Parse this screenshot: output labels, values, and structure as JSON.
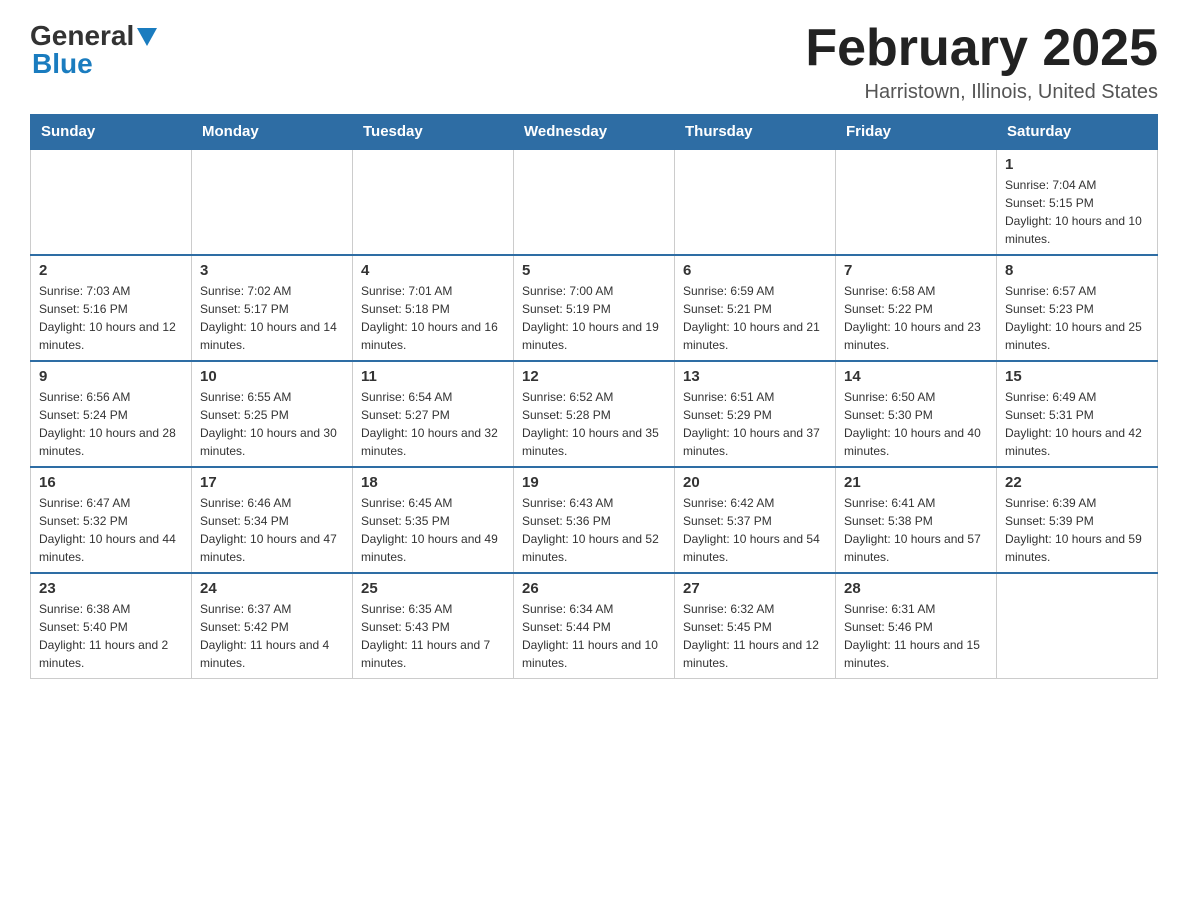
{
  "header": {
    "logo": {
      "general_text": "General",
      "blue_text": "Blue"
    },
    "title": "February 2025",
    "subtitle": "Harristown, Illinois, United States"
  },
  "days_of_week": [
    "Sunday",
    "Monday",
    "Tuesday",
    "Wednesday",
    "Thursday",
    "Friday",
    "Saturday"
  ],
  "weeks": [
    [
      {
        "day": "",
        "info": ""
      },
      {
        "day": "",
        "info": ""
      },
      {
        "day": "",
        "info": ""
      },
      {
        "day": "",
        "info": ""
      },
      {
        "day": "",
        "info": ""
      },
      {
        "day": "",
        "info": ""
      },
      {
        "day": "1",
        "info": "Sunrise: 7:04 AM\nSunset: 5:15 PM\nDaylight: 10 hours and 10 minutes."
      }
    ],
    [
      {
        "day": "2",
        "info": "Sunrise: 7:03 AM\nSunset: 5:16 PM\nDaylight: 10 hours and 12 minutes."
      },
      {
        "day": "3",
        "info": "Sunrise: 7:02 AM\nSunset: 5:17 PM\nDaylight: 10 hours and 14 minutes."
      },
      {
        "day": "4",
        "info": "Sunrise: 7:01 AM\nSunset: 5:18 PM\nDaylight: 10 hours and 16 minutes."
      },
      {
        "day": "5",
        "info": "Sunrise: 7:00 AM\nSunset: 5:19 PM\nDaylight: 10 hours and 19 minutes."
      },
      {
        "day": "6",
        "info": "Sunrise: 6:59 AM\nSunset: 5:21 PM\nDaylight: 10 hours and 21 minutes."
      },
      {
        "day": "7",
        "info": "Sunrise: 6:58 AM\nSunset: 5:22 PM\nDaylight: 10 hours and 23 minutes."
      },
      {
        "day": "8",
        "info": "Sunrise: 6:57 AM\nSunset: 5:23 PM\nDaylight: 10 hours and 25 minutes."
      }
    ],
    [
      {
        "day": "9",
        "info": "Sunrise: 6:56 AM\nSunset: 5:24 PM\nDaylight: 10 hours and 28 minutes."
      },
      {
        "day": "10",
        "info": "Sunrise: 6:55 AM\nSunset: 5:25 PM\nDaylight: 10 hours and 30 minutes."
      },
      {
        "day": "11",
        "info": "Sunrise: 6:54 AM\nSunset: 5:27 PM\nDaylight: 10 hours and 32 minutes."
      },
      {
        "day": "12",
        "info": "Sunrise: 6:52 AM\nSunset: 5:28 PM\nDaylight: 10 hours and 35 minutes."
      },
      {
        "day": "13",
        "info": "Sunrise: 6:51 AM\nSunset: 5:29 PM\nDaylight: 10 hours and 37 minutes."
      },
      {
        "day": "14",
        "info": "Sunrise: 6:50 AM\nSunset: 5:30 PM\nDaylight: 10 hours and 40 minutes."
      },
      {
        "day": "15",
        "info": "Sunrise: 6:49 AM\nSunset: 5:31 PM\nDaylight: 10 hours and 42 minutes."
      }
    ],
    [
      {
        "day": "16",
        "info": "Sunrise: 6:47 AM\nSunset: 5:32 PM\nDaylight: 10 hours and 44 minutes."
      },
      {
        "day": "17",
        "info": "Sunrise: 6:46 AM\nSunset: 5:34 PM\nDaylight: 10 hours and 47 minutes."
      },
      {
        "day": "18",
        "info": "Sunrise: 6:45 AM\nSunset: 5:35 PM\nDaylight: 10 hours and 49 minutes."
      },
      {
        "day": "19",
        "info": "Sunrise: 6:43 AM\nSunset: 5:36 PM\nDaylight: 10 hours and 52 minutes."
      },
      {
        "day": "20",
        "info": "Sunrise: 6:42 AM\nSunset: 5:37 PM\nDaylight: 10 hours and 54 minutes."
      },
      {
        "day": "21",
        "info": "Sunrise: 6:41 AM\nSunset: 5:38 PM\nDaylight: 10 hours and 57 minutes."
      },
      {
        "day": "22",
        "info": "Sunrise: 6:39 AM\nSunset: 5:39 PM\nDaylight: 10 hours and 59 minutes."
      }
    ],
    [
      {
        "day": "23",
        "info": "Sunrise: 6:38 AM\nSunset: 5:40 PM\nDaylight: 11 hours and 2 minutes."
      },
      {
        "day": "24",
        "info": "Sunrise: 6:37 AM\nSunset: 5:42 PM\nDaylight: 11 hours and 4 minutes."
      },
      {
        "day": "25",
        "info": "Sunrise: 6:35 AM\nSunset: 5:43 PM\nDaylight: 11 hours and 7 minutes."
      },
      {
        "day": "26",
        "info": "Sunrise: 6:34 AM\nSunset: 5:44 PM\nDaylight: 11 hours and 10 minutes."
      },
      {
        "day": "27",
        "info": "Sunrise: 6:32 AM\nSunset: 5:45 PM\nDaylight: 11 hours and 12 minutes."
      },
      {
        "day": "28",
        "info": "Sunrise: 6:31 AM\nSunset: 5:46 PM\nDaylight: 11 hours and 15 minutes."
      },
      {
        "day": "",
        "info": ""
      }
    ]
  ]
}
